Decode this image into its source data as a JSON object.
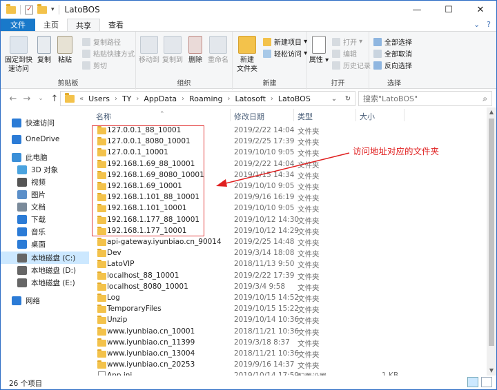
{
  "window": {
    "title": "LatoBOS"
  },
  "ribbon_tabs": [
    "文件",
    "主页",
    "共享",
    "查看"
  ],
  "ribbon": {
    "clipboard": {
      "pin": "固定到快速访问",
      "copy": "复制",
      "paste": "粘贴",
      "copy_path": "复制路径",
      "paste_shortcut": "粘贴快捷方式",
      "cut": "剪切",
      "label": "剪贴板"
    },
    "organize": {
      "move_to": "移动到",
      "copy_to": "复制到",
      "delete": "删除",
      "rename": "重命名",
      "label": "组织"
    },
    "new": {
      "new_folder_line1": "新建",
      "new_folder_line2": "文件夹",
      "new_item": "新建项目",
      "easy_access": "轻松访问",
      "label": "新建"
    },
    "open": {
      "properties": "属性",
      "open": "打开",
      "edit": "编辑",
      "history": "历史记录",
      "label": "打开"
    },
    "select": {
      "select_all": "全部选择",
      "select_none": "全部取消",
      "invert": "反向选择",
      "label": "选择"
    }
  },
  "address": {
    "overflow": "«",
    "crumbs": [
      "Users",
      "TY",
      "AppData",
      "Roaming",
      "Latosoft",
      "LatoBOS"
    ],
    "search_placeholder": "搜索\"LatoBOS\""
  },
  "nav_pane": [
    {
      "label": "快速访问",
      "icon": "star-icon",
      "color": "#2b7bd6"
    },
    {
      "label": "OneDrive",
      "icon": "cloud-icon",
      "color": "#2b7bd6"
    },
    {
      "label": "此电脑",
      "icon": "computer-icon",
      "color": "#3a8fd8"
    },
    {
      "label": "3D 对象",
      "icon": "cube-icon",
      "color": "#4aa3df"
    },
    {
      "label": "视频",
      "icon": "video-icon",
      "color": "#555"
    },
    {
      "label": "图片",
      "icon": "picture-icon",
      "color": "#5b8fc9"
    },
    {
      "label": "文档",
      "icon": "document-icon",
      "color": "#7a8a9a"
    },
    {
      "label": "下载",
      "icon": "download-icon",
      "color": "#2b7bd6"
    },
    {
      "label": "音乐",
      "icon": "music-icon",
      "color": "#2b7bd6"
    },
    {
      "label": "桌面",
      "icon": "desktop-icon",
      "color": "#2b7bd6"
    },
    {
      "label": "本地磁盘 (C:)",
      "icon": "drive-icon",
      "color": "#666"
    },
    {
      "label": "本地磁盘 (D:)",
      "icon": "drive-icon",
      "color": "#666"
    },
    {
      "label": "本地磁盘 (E:)",
      "icon": "drive-icon",
      "color": "#666"
    },
    {
      "label": "网络",
      "icon": "network-icon",
      "color": "#2b7bd6"
    }
  ],
  "columns": {
    "name": "名称",
    "date": "修改日期",
    "type": "类型",
    "size": "大小"
  },
  "files": [
    {
      "name": "127.0.0.1_88_10001",
      "date": "2019/2/22 14:04",
      "type": "文件夹",
      "size": "",
      "kind": "folder"
    },
    {
      "name": "127.0.0.1_8080_10001",
      "date": "2019/2/25 17:39",
      "type": "文件夹",
      "size": "",
      "kind": "folder"
    },
    {
      "name": "127.0.0.1_10001",
      "date": "2019/10/10 9:05",
      "type": "文件夹",
      "size": "",
      "kind": "folder"
    },
    {
      "name": "192.168.1.69_88_10001",
      "date": "2019/2/22 14:04",
      "type": "文件夹",
      "size": "",
      "kind": "folder"
    },
    {
      "name": "192.168.1.69_8080_10001",
      "date": "2019/1/15 14:34",
      "type": "文件夹",
      "size": "",
      "kind": "folder"
    },
    {
      "name": "192.168.1.69_10001",
      "date": "2019/10/10 9:05",
      "type": "文件夹",
      "size": "",
      "kind": "folder"
    },
    {
      "name": "192.168.1.101_88_10001",
      "date": "2019/9/16 16:19",
      "type": "文件夹",
      "size": "",
      "kind": "folder"
    },
    {
      "name": "192.168.1.101_10001",
      "date": "2019/10/10 9:05",
      "type": "文件夹",
      "size": "",
      "kind": "folder"
    },
    {
      "name": "192.168.1.177_88_10001",
      "date": "2019/10/12 14:30",
      "type": "文件夹",
      "size": "",
      "kind": "folder"
    },
    {
      "name": "192.168.1.177_10001",
      "date": "2019/10/12 14:29",
      "type": "文件夹",
      "size": "",
      "kind": "folder"
    },
    {
      "name": "api-gateway.iyunbiao.cn_90014",
      "date": "2019/2/25 14:48",
      "type": "文件夹",
      "size": "",
      "kind": "folder"
    },
    {
      "name": "Dev",
      "date": "2019/3/14 18:08",
      "type": "文件夹",
      "size": "",
      "kind": "folder"
    },
    {
      "name": "LatoVIP",
      "date": "2018/11/13 9:50",
      "type": "文件夹",
      "size": "",
      "kind": "folder"
    },
    {
      "name": "localhost_88_10001",
      "date": "2019/2/22 17:39",
      "type": "文件夹",
      "size": "",
      "kind": "folder"
    },
    {
      "name": "localhost_8080_10001",
      "date": "2019/3/4 9:58",
      "type": "文件夹",
      "size": "",
      "kind": "folder"
    },
    {
      "name": "Log",
      "date": "2019/10/15 14:52",
      "type": "文件夹",
      "size": "",
      "kind": "folder"
    },
    {
      "name": "TemporaryFiles",
      "date": "2019/10/15 15:22",
      "type": "文件夹",
      "size": "",
      "kind": "folder"
    },
    {
      "name": "Unzip",
      "date": "2019/10/14 10:36",
      "type": "文件夹",
      "size": "",
      "kind": "folder"
    },
    {
      "name": "www.iyunbiao.cn_10001",
      "date": "2018/11/21 10:36",
      "type": "文件夹",
      "size": "",
      "kind": "folder"
    },
    {
      "name": "www.iyunbiao.cn_11399",
      "date": "2019/3/18 8:37",
      "type": "文件夹",
      "size": "",
      "kind": "folder"
    },
    {
      "name": "www.iyunbiao.cn_13004",
      "date": "2018/11/21 10:36",
      "type": "文件夹",
      "size": "",
      "kind": "folder"
    },
    {
      "name": "www.iyunbiao.cn_20253",
      "date": "2019/9/16 14:37",
      "type": "文件夹",
      "size": "",
      "kind": "folder"
    },
    {
      "name": "App.ini",
      "date": "2019/10/14 17:59",
      "type": "配置设置",
      "size": "1 KB",
      "kind": "file"
    }
  ],
  "status": {
    "count": "26 个项目"
  },
  "annotation": {
    "text": "访问地址对应的文件夹",
    "color": "#e02020"
  }
}
